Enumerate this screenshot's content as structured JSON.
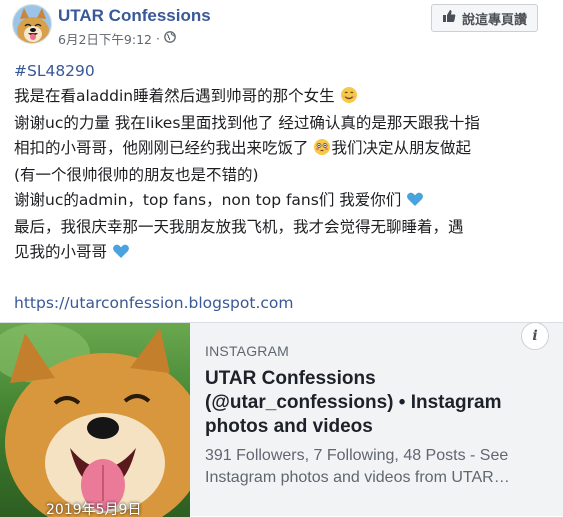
{
  "header": {
    "page_name": "UTAR Confessions",
    "timestamp": "6月2日下午9:12",
    "separator": "·",
    "privacy_icon": "globe-icon",
    "like_button_label": "說這專頁讚",
    "like_icon": "thumbs-up-icon"
  },
  "post": {
    "hashtag": "#SL48290",
    "lines": [
      "我是在看aladdin睡着然后遇到帅哥的那个女生",
      "谢谢uc的力量 我在likes里面找到他了 经过确认真的是那天跟我十指",
      "相扣的小哥哥，他刚刚已经约我出来吃饭了",
      "我们决定从朋友做起",
      "(有一个很帅很帅的朋友也是不错的)",
      "谢谢uc的admin，top fans，non top fans们 我爱你们",
      "最后，我很庆幸那一天我朋友放我飞机，我才会觉得无聊睡着，遇",
      "见我的小哥哥"
    ],
    "link": "https://utarconfession.blogspot.com",
    "emojis": [
      "smiling-face-icon",
      "flushed-face-icon",
      "blue-heart-icon",
      "blue-heart-icon"
    ]
  },
  "card": {
    "domain": "INSTAGRAM",
    "title_line1": "UTAR Confessions",
    "title_line2": "(@utar_confessions) • Instagram",
    "title_line3": "photos and videos",
    "desc_line1": "391 Followers, 7 Following, 48 Posts - See",
    "desc_line2": "Instagram photos and videos from UTAR…",
    "image_caption": "2019年5月9日",
    "info_label": "i"
  }
}
